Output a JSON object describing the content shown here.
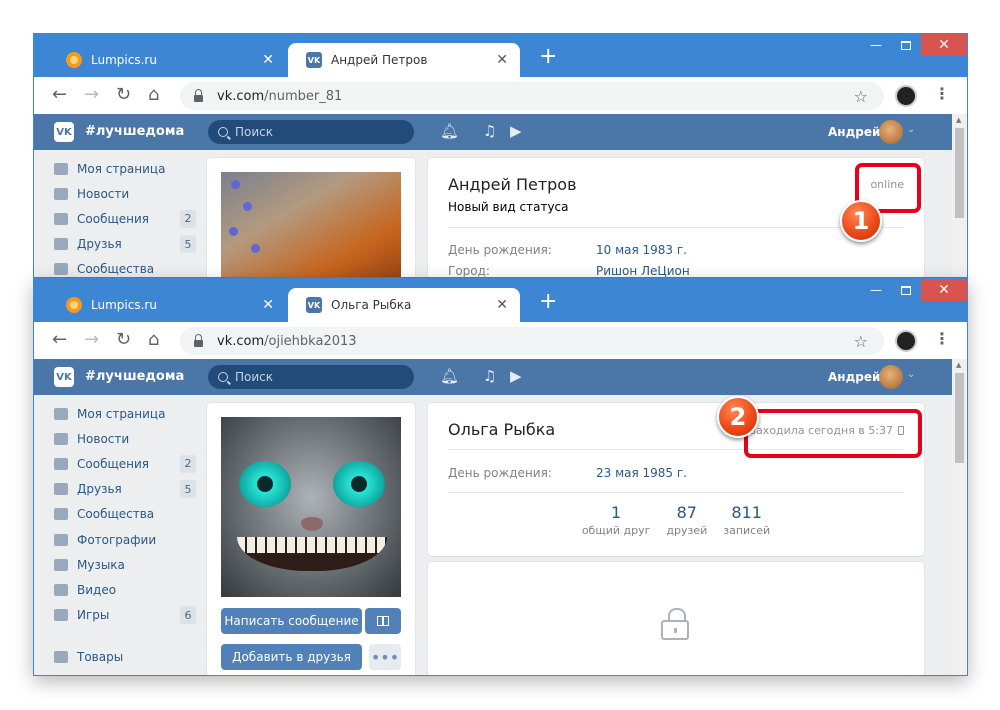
{
  "colors": {
    "vk_blue": "#4a76a8",
    "chrome_frame": "#3d86d3",
    "annotation_red": "#e5001b"
  },
  "windows": [
    {
      "tabs": [
        {
          "title": "Lumpics.ru",
          "favicon": "lumpics-icon"
        },
        {
          "title": "Андрей Петров",
          "favicon": "vk-icon"
        }
      ],
      "url_host": "vk.com",
      "url_path": "/number_81",
      "header": {
        "brand": "#лучшедома",
        "search_placeholder": "Поиск",
        "user_name": "Андрей"
      },
      "menu": [
        {
          "label": "Моя страница",
          "icon": "home-icon"
        },
        {
          "label": "Новости",
          "icon": "news-icon"
        },
        {
          "label": "Сообщения",
          "icon": "chat-icon",
          "badge": "2"
        },
        {
          "label": "Друзья",
          "icon": "friends-icon",
          "badge": "5"
        },
        {
          "label": "Сообщества",
          "icon": "communities-icon"
        }
      ],
      "profile": {
        "name": "Андрей Петров",
        "status": "Новый вид статуса",
        "online": "online",
        "birthday_label": "День рождения:",
        "birthday_value": "10 мая 1983 г.",
        "city_label": "Город:",
        "city_value": "Ришон ЛеЦион"
      }
    },
    {
      "tabs": [
        {
          "title": "Lumpics.ru",
          "favicon": "lumpics-icon"
        },
        {
          "title": "Ольга Рыбка",
          "favicon": "vk-icon"
        }
      ],
      "url_host": "vk.com",
      "url_path": "/ojiehbka2013",
      "header": {
        "brand": "#лучшедома",
        "search_placeholder": "Поиск",
        "user_name": "Андрей"
      },
      "menu": [
        {
          "label": "Моя страница",
          "icon": "home-icon"
        },
        {
          "label": "Новости",
          "icon": "news-icon"
        },
        {
          "label": "Сообщения",
          "icon": "chat-icon",
          "badge": "2"
        },
        {
          "label": "Друзья",
          "icon": "friends-icon",
          "badge": "5"
        },
        {
          "label": "Сообщества",
          "icon": "communities-icon"
        },
        {
          "label": "Фотографии",
          "icon": "camera-icon"
        },
        {
          "label": "Музыка",
          "icon": "music-icon"
        },
        {
          "label": "Видео",
          "icon": "video-icon"
        },
        {
          "label": "Игры",
          "icon": "gamepad-icon",
          "badge": "6"
        },
        {
          "label": "Товары",
          "icon": "bag-icon"
        }
      ],
      "profile": {
        "name": "Ольга Рыбка",
        "last_seen": "заходила сегодня в 5:37",
        "birthday_label": "День рождения:",
        "birthday_value": "23 мая 1985 г.",
        "counters": [
          {
            "value": "1",
            "label": "общий друг"
          },
          {
            "value": "87",
            "label": "друзей"
          },
          {
            "value": "811",
            "label": "записей"
          }
        ],
        "btn_message": "Написать сообщение",
        "btn_add_friend": "Добавить в друзья"
      }
    }
  ],
  "annotations": [
    "1",
    "2"
  ]
}
